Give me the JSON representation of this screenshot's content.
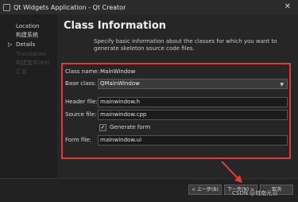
{
  "window": {
    "title": "Qt Widgets Application - Qt Creator",
    "close_glyph": "✕"
  },
  "sidebar": {
    "marker": "▷",
    "steps": [
      {
        "label": "Location",
        "state": "done"
      },
      {
        "label": "构建系统",
        "state": "done"
      },
      {
        "label": "Details",
        "state": "current"
      },
      {
        "label": "Translation",
        "state": "pending"
      },
      {
        "label": "构建套件(Kit)",
        "state": "pending"
      },
      {
        "label": "汇总",
        "state": "pending"
      }
    ]
  },
  "page": {
    "title": "Class Information",
    "description": "Specify basic information about the classes for which you want to generate skeleton source code files."
  },
  "form": {
    "class_name": {
      "label": "Class name:",
      "value": "MainWindow"
    },
    "base_class": {
      "label": "Base class:",
      "value": "QMainWindow"
    },
    "header_file": {
      "label": "Header file:",
      "value": "mainwindow.h"
    },
    "source_file": {
      "label": "Source file:",
      "value": "mainwindow.cpp"
    },
    "generate_form": {
      "label": "Generate form",
      "checked": true,
      "check_glyph": "✓"
    },
    "form_file": {
      "label": "Form file:",
      "value": "mainwindow.ui"
    }
  },
  "footer": {
    "back_label": "< 上一步(B)",
    "next_label": "下一步(N) >",
    "cancel_label": "取消"
  },
  "watermark": "CSDN @城南光羽",
  "colors": {
    "highlight_border": "#e03a3a",
    "annotation_arrow": "#e03a3a"
  }
}
